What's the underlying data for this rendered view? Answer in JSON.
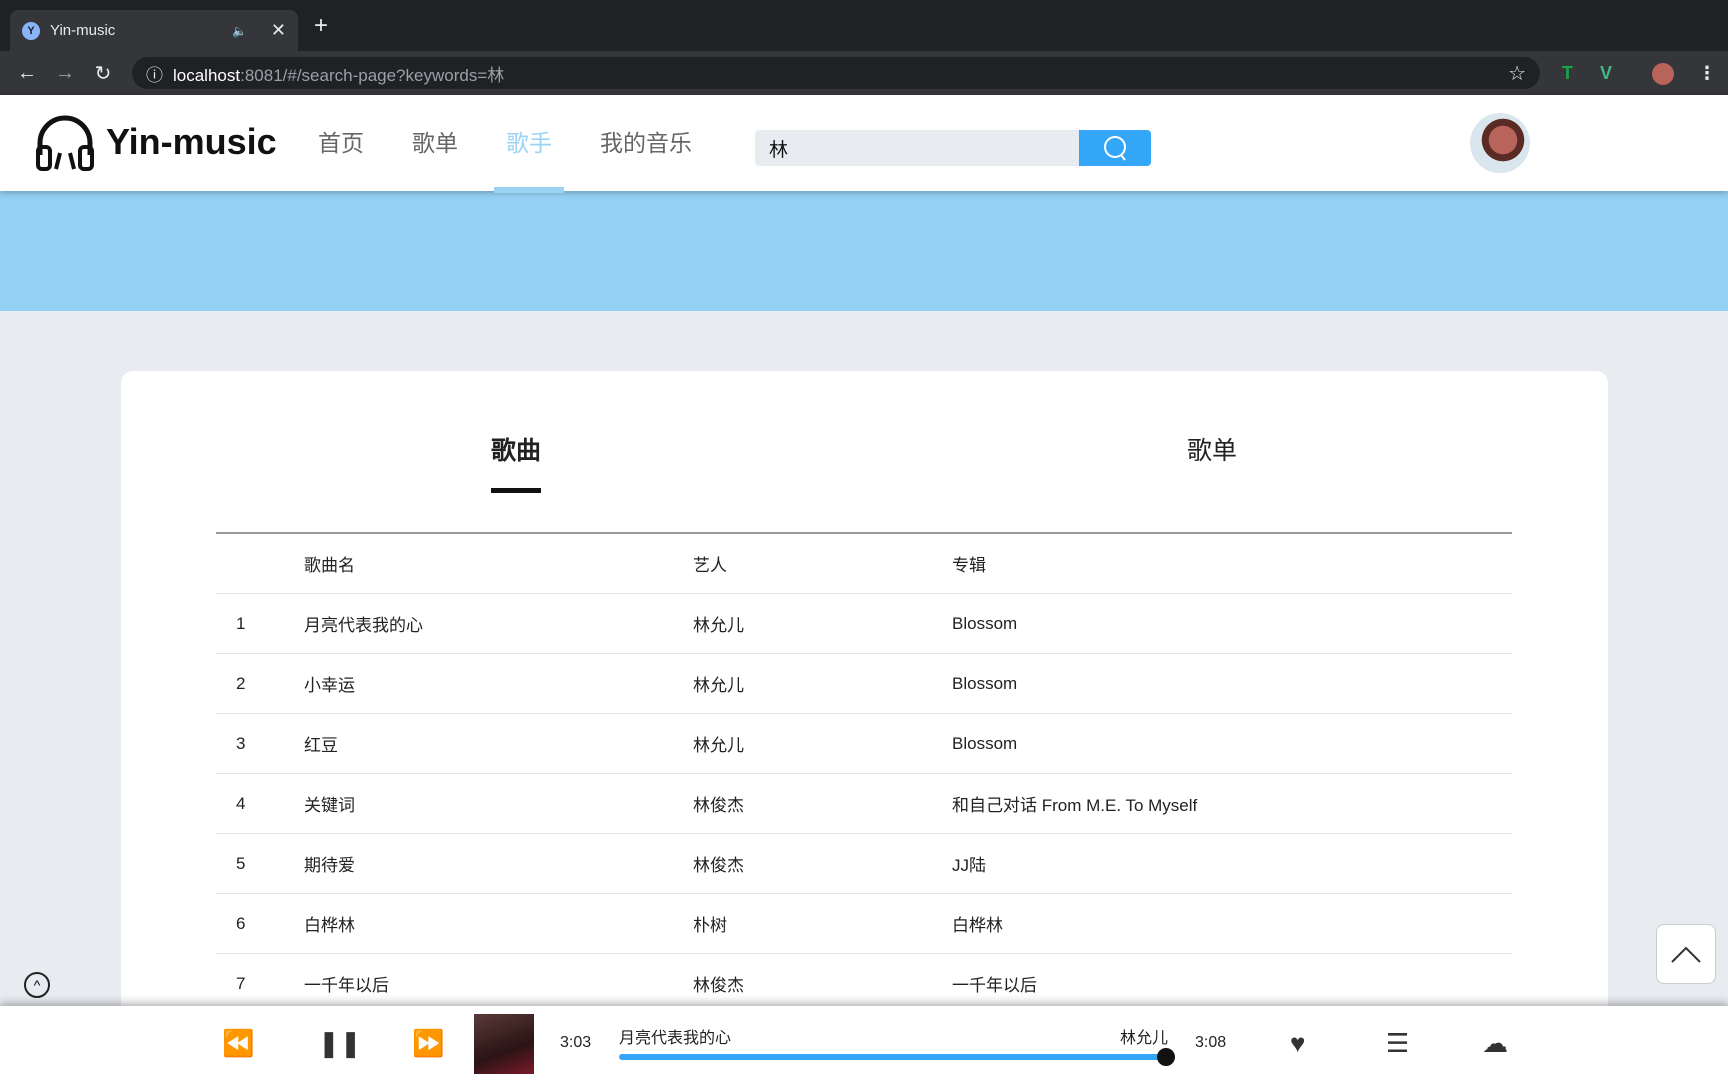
{
  "browser": {
    "tab_title": "Yin-music",
    "url_host": "localhost",
    "url_rest": ":8081/#/search-page?keywords=林"
  },
  "header": {
    "logo": "Yin-music",
    "menu": [
      "首页",
      "歌单",
      "歌手",
      "我的音乐"
    ],
    "active_menu": "歌手",
    "search_value": "林"
  },
  "tabs": [
    "歌曲",
    "歌单"
  ],
  "table": {
    "headers": [
      "",
      "歌曲名",
      "艺人",
      "专辑"
    ],
    "rows": [
      [
        "1",
        "月亮代表我的心",
        "林允儿",
        "Blossom"
      ],
      [
        "2",
        "小幸运",
        "林允儿",
        "Blossom"
      ],
      [
        "3",
        "红豆",
        "林允儿",
        "Blossom"
      ],
      [
        "4",
        "关键词",
        "林俊杰",
        "和自己对话 From M.E. To Myself"
      ],
      [
        "5",
        "期待爱",
        "林俊杰",
        "JJ陆"
      ],
      [
        "6",
        "白桦林",
        "朴树",
        "白桦林"
      ],
      [
        "7",
        "一千年以后",
        "林俊杰",
        "一千年以后"
      ]
    ]
  },
  "player": {
    "current_time": "3:03",
    "total_time": "3:08",
    "song": "月亮代表我的心",
    "artist": "林允儿",
    "progress": 0.97
  },
  "colors": {
    "accent": "#33a6f7",
    "banner": "#95d1f5",
    "active_nav": "#9bd3f5"
  }
}
